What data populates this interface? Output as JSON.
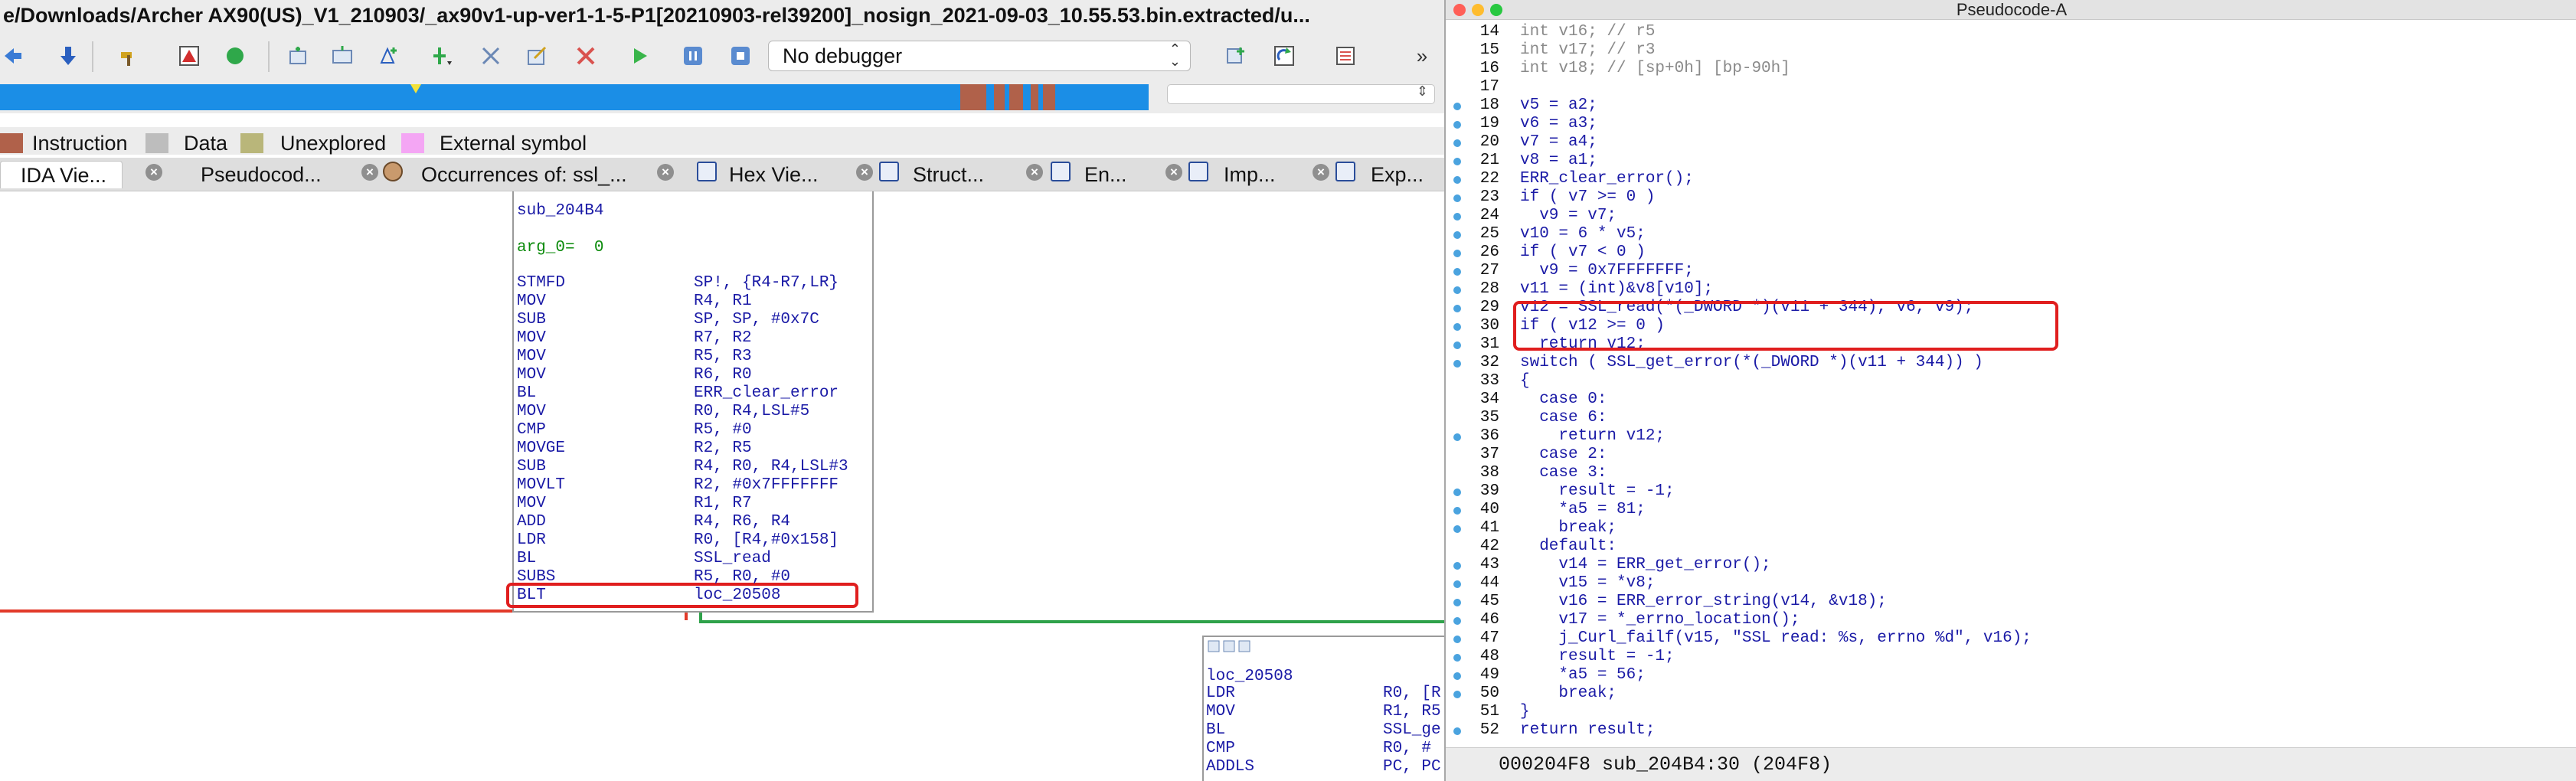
{
  "ida": {
    "title": "e/Downloads/Archer AX90(US)_V1_210903/_ax90v1-up-ver1-1-5-P1[20210903-rel39200]_nosign_2021-09-03_10.55.53.bin.extracted/u...",
    "debugger": "No debugger",
    "legend": [
      {
        "label": "Instruction",
        "color": "#b0614a"
      },
      {
        "label": "Data",
        "color": "#bdbdbd"
      },
      {
        "label": "Unexplored",
        "color": "#b9b67a"
      },
      {
        "label": "External symbol",
        "color": "#f4a6f4"
      }
    ],
    "tabs": [
      {
        "label": "IDA Vie..."
      },
      {
        "label": "Pseudocod..."
      },
      {
        "label": "Occurrences of: ssl_..."
      },
      {
        "label": "Hex Vie..."
      },
      {
        "label": "Struct..."
      },
      {
        "label": "En..."
      },
      {
        "label": "Imp..."
      },
      {
        "label": "Exp..."
      }
    ],
    "main_block": {
      "header": "sub_204B4",
      "arg": "arg_0=  0",
      "rows": [
        {
          "op": "STMFD",
          "args": "SP!, {R4-R7,LR}"
        },
        {
          "op": "MOV",
          "args": "R4, R1"
        },
        {
          "op": "SUB",
          "args": "SP, SP, #0x7C"
        },
        {
          "op": "MOV",
          "args": "R7, R2"
        },
        {
          "op": "MOV",
          "args": "R5, R3"
        },
        {
          "op": "MOV",
          "args": "R6, R0"
        },
        {
          "op": "BL",
          "args": "ERR_clear_error"
        },
        {
          "op": "MOV",
          "args": "R0, R4,LSL#5"
        },
        {
          "op": "CMP",
          "args": "R5, #0"
        },
        {
          "op": "MOVGE",
          "args": "R2, R5"
        },
        {
          "op": "SUB",
          "args": "R4, R0, R4,LSL#3"
        },
        {
          "op": "MOVLT",
          "args": "R2, #0x7FFFFFFF"
        },
        {
          "op": "MOV",
          "args": "R1, R7"
        },
        {
          "op": "ADD",
          "args": "R4, R6, R4"
        },
        {
          "op": "LDR",
          "args": "R0, [R4,#0x158]"
        },
        {
          "op": "BL",
          "args": "SSL_read"
        },
        {
          "op": "SUBS",
          "args": "R5, R0, #0"
        },
        {
          "op": "BLT",
          "args": "loc_20508"
        }
      ]
    },
    "loc_block": {
      "header": "loc_20508",
      "rows": [
        {
          "op": "LDR",
          "args": "R0, [R"
        },
        {
          "op": "MOV",
          "args": "R1, R5"
        },
        {
          "op": "BL",
          "args": "SSL_ge"
        },
        {
          "op": "CMP",
          "args": "R0, #"
        },
        {
          "op": "ADDLS",
          "args": "PC, PC"
        }
      ]
    }
  },
  "pseudocode": {
    "title": "Pseudocode-A",
    "lines": [
      {
        "n": "14",
        "t": "int v16; // r5",
        "dot": false
      },
      {
        "n": "15",
        "t": "int v17; // r3",
        "dot": false
      },
      {
        "n": "16",
        "t": "int v18; // [sp+0h] [bp-90h]",
        "dot": false
      },
      {
        "n": "17",
        "t": "",
        "dot": false
      },
      {
        "n": "18",
        "t": "v5 = a2;",
        "dot": true
      },
      {
        "n": "19",
        "t": "v6 = a3;",
        "dot": true
      },
      {
        "n": "20",
        "t": "v7 = a4;",
        "dot": true
      },
      {
        "n": "21",
        "t": "v8 = a1;",
        "dot": true
      },
      {
        "n": "22",
        "t": "ERR_clear_error();",
        "dot": true
      },
      {
        "n": "23",
        "t": "if ( v7 >= 0 )",
        "dot": true
      },
      {
        "n": "24",
        "t": "  v9 = v7;",
        "dot": true
      },
      {
        "n": "25",
        "t": "v10 = 6 * v5;",
        "dot": true
      },
      {
        "n": "26",
        "t": "if ( v7 < 0 )",
        "dot": true
      },
      {
        "n": "27",
        "t": "  v9 = 0x7FFFFFFF;",
        "dot": true
      },
      {
        "n": "28",
        "t": "v11 = (int)&v8[v10];",
        "dot": true
      },
      {
        "n": "29",
        "t": "v12 = SSL_read(*(_DWORD *)(v11 + 344), v6, v9);",
        "dot": true
      },
      {
        "n": "30",
        "t": "if ( v12 >= 0 )",
        "dot": true
      },
      {
        "n": "31",
        "t": "  return v12;",
        "dot": true
      },
      {
        "n": "32",
        "t": "switch ( SSL_get_error(*(_DWORD *)(v11 + 344)) )",
        "dot": true
      },
      {
        "n": "33",
        "t": "{",
        "dot": false
      },
      {
        "n": "34",
        "t": "  case 0:",
        "dot": false
      },
      {
        "n": "35",
        "t": "  case 6:",
        "dot": false
      },
      {
        "n": "36",
        "t": "    return v12;",
        "dot": true
      },
      {
        "n": "37",
        "t": "  case 2:",
        "dot": false
      },
      {
        "n": "38",
        "t": "  case 3:",
        "dot": false
      },
      {
        "n": "39",
        "t": "    result = -1;",
        "dot": true
      },
      {
        "n": "40",
        "t": "    *a5 = 81;",
        "dot": true
      },
      {
        "n": "41",
        "t": "    break;",
        "dot": true
      },
      {
        "n": "42",
        "t": "  default:",
        "dot": false
      },
      {
        "n": "43",
        "t": "    v14 = ERR_get_error();",
        "dot": true
      },
      {
        "n": "44",
        "t": "    v15 = *v8;",
        "dot": true
      },
      {
        "n": "45",
        "t": "    v16 = ERR_error_string(v14, &v18);",
        "dot": true
      },
      {
        "n": "46",
        "t": "    v17 = *_errno_location();",
        "dot": true
      },
      {
        "n": "47",
        "t": "    j_Curl_failf(v15, \"SSL read: %s, errno %d\", v16);",
        "dot": true
      },
      {
        "n": "48",
        "t": "    result = -1;",
        "dot": true
      },
      {
        "n": "49",
        "t": "    *a5 = 56;",
        "dot": true
      },
      {
        "n": "50",
        "t": "    break;",
        "dot": true
      },
      {
        "n": "51",
        "t": "}",
        "dot": false
      },
      {
        "n": "52",
        "t": "return result;",
        "dot": true
      }
    ],
    "status": "000204F8 sub_204B4:30 (204F8)"
  }
}
